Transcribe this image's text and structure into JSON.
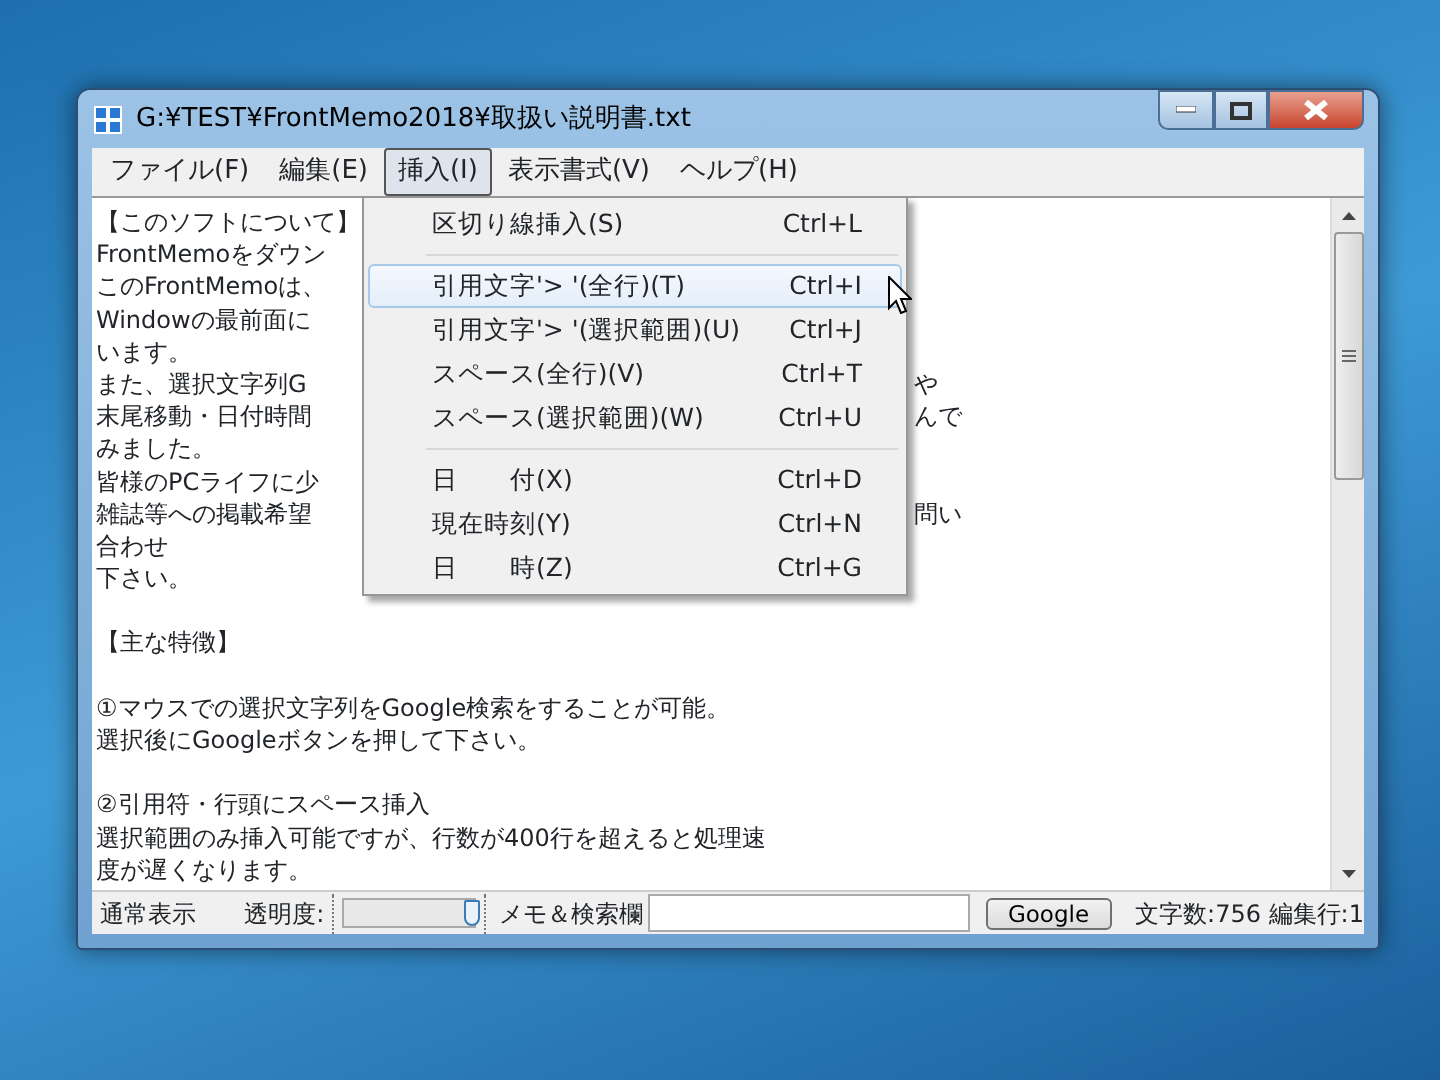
{
  "window": {
    "title": "G:¥TEST¥FrontMemo2018¥取扱い説明書.txt"
  },
  "menu_bar": [
    {
      "label": "ファイル(F)",
      "selected": false
    },
    {
      "label": "編集(E)",
      "selected": false
    },
    {
      "label": "挿入(I)",
      "selected": true
    },
    {
      "label": "表示書式(V)",
      "selected": false
    },
    {
      "label": "ヘルプ(H)",
      "selected": false
    }
  ],
  "dropdown_menu": [
    {
      "kind": "item",
      "label": "区切り線挿入(S)",
      "shortcut": "Ctrl+L",
      "selected": false
    },
    {
      "kind": "separator"
    },
    {
      "kind": "item",
      "label": "引用文字'> '(全行)(T)",
      "shortcut": "Ctrl+I",
      "selected": true
    },
    {
      "kind": "item",
      "label": "引用文字'> '(選択範囲)(U)",
      "shortcut": "Ctrl+J",
      "selected": false
    },
    {
      "kind": "item",
      "label": "スペース(全行)(V)",
      "shortcut": "Ctrl+T",
      "selected": false
    },
    {
      "kind": "item",
      "label": "スペース(選択範囲)(W)",
      "shortcut": "Ctrl+U",
      "selected": false
    },
    {
      "kind": "separator"
    },
    {
      "kind": "item",
      "label": "日　　付(X)",
      "shortcut": "Ctrl+D",
      "selected": false
    },
    {
      "kind": "item",
      "label": "現在時刻(Y)",
      "shortcut": "Ctrl+N",
      "selected": false
    },
    {
      "kind": "item",
      "label": "日　　時(Z)",
      "shortcut": "Ctrl+G",
      "selected": false
    }
  ],
  "editor_paragraphs": [
    {
      "lines": [
        {
          "text": "【このソフトについて】"
        },
        {
          "text": "FrontMemoをダウン"
        },
        {
          "text": "このFrontMemoは、"
        },
        {
          "text": "Windowの最前面に"
        },
        {
          "text": "います。"
        },
        {
          "text": "また、選択文字列G",
          "text_right": "や"
        },
        {
          "text": "末尾移動・日付時間",
          "text_right": "んで"
        },
        {
          "text": "みました。"
        },
        {
          "text": "皆様のPCライフに少"
        },
        {
          "text": "雑誌等への掲載希望",
          "text_right": "問い"
        },
        {
          "text": "合わせ"
        },
        {
          "text": "下さい。"
        }
      ]
    },
    {
      "lines": [
        {
          "text": "【主な特徴】"
        }
      ]
    },
    {
      "lines": [
        {
          "text": "①マウスでの選択文字列をGoogle検索をすることが可能。"
        },
        {
          "text": "選択後にGoogleボタンを押して下さい。"
        }
      ]
    },
    {
      "lines": [
        {
          "text": "②引用符・行頭にスペース挿入"
        },
        {
          "text": "選択範囲のみ挿入可能ですが、行数が400行を超えると処理速"
        },
        {
          "text": "度が遅くなります。"
        }
      ]
    }
  ],
  "status_bar": {
    "mode": "通常表示",
    "opacity_label": "透明度:",
    "opacity": {
      "level": 1
    },
    "memo_label": "メモ＆検索欄",
    "google_button": "Google",
    "counts": "文字数:756 編集行:1"
  }
}
